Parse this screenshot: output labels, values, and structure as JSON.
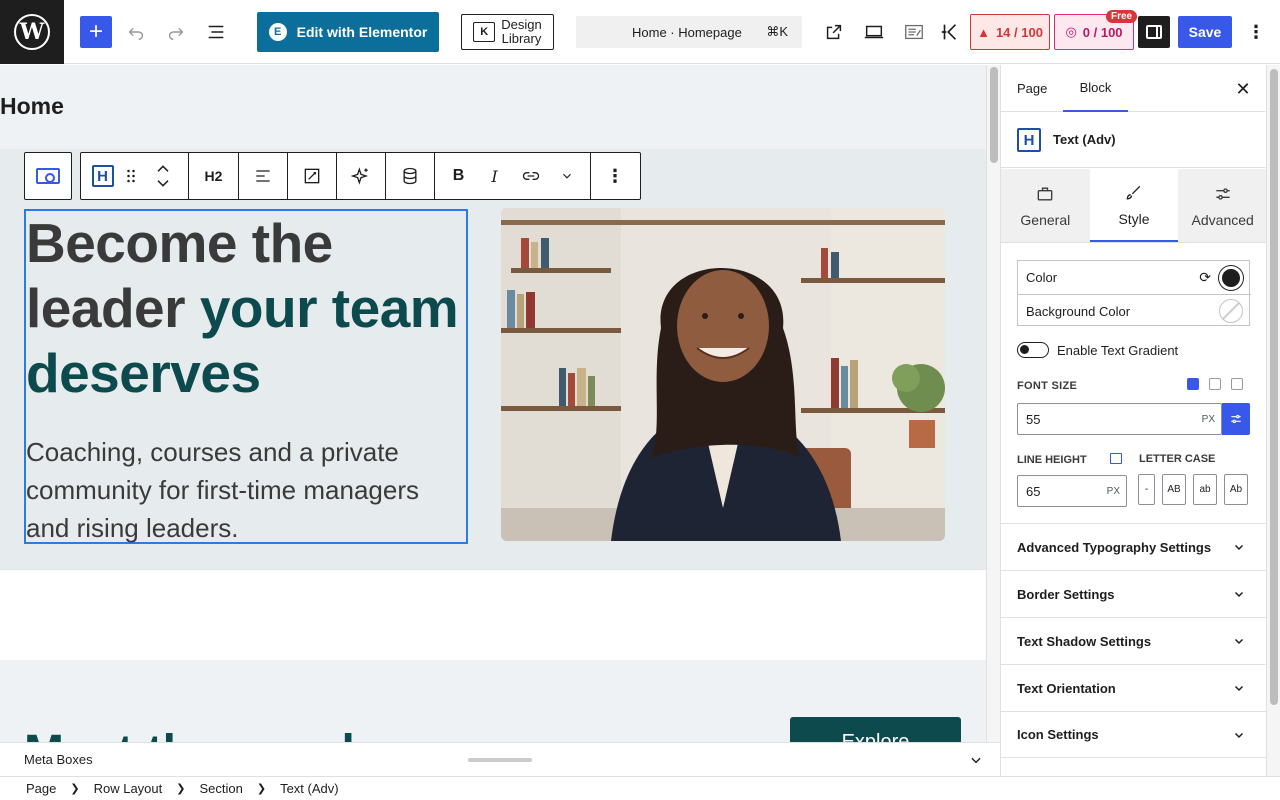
{
  "topbar": {
    "elementor_label": "Edit with Elementor",
    "design_library_line1": "Design",
    "design_library_line2": "Library",
    "command_title": "Home · Homepage",
    "command_shortcut": "⌘K",
    "badge_red": "14 / 100",
    "badge_pink": "0 / 100",
    "badge_free": "Free",
    "save_label": "Save"
  },
  "canvas": {
    "page_title": "Home",
    "headline_dark": "Become the leader ",
    "headline_accent": "your team deserves",
    "subtext": "Coaching, courses and a private community for first-time managers and rising leaders.",
    "section2_title": "Meet the coach",
    "explore_label": "Explore",
    "heading_level": "H2"
  },
  "meta_boxes": {
    "label": "Meta Boxes"
  },
  "breadcrumb": [
    "Page",
    "Row Layout",
    "Section",
    "Text (Adv)"
  ],
  "sidebar": {
    "tab_page": "Page",
    "tab_block": "Block",
    "block_name": "Text (Adv)",
    "subtabs": [
      "General",
      "Style",
      "Advanced"
    ],
    "color_label": "Color",
    "bg_color_label": "Background Color",
    "gradient_label": "Enable Text Gradient",
    "font_size_label": "FONT SIZE",
    "font_size_value": "55",
    "unit": "PX",
    "line_height_label": "LINE HEIGHT",
    "line_height_value": "65",
    "letter_case_label": "LETTER CASE",
    "letter_case_options": [
      "-",
      "AB",
      "ab",
      "Ab"
    ],
    "accordions": [
      "Advanced Typography Settings",
      "Border Settings",
      "Text Shadow Settings",
      "Text Orientation",
      "Icon Settings"
    ]
  },
  "colors": {
    "accent": "#3858e9",
    "brand_teal": "#0d4a4d",
    "elementor": "#0c6e9a",
    "text_color_swatch": "#1e1e1e"
  }
}
